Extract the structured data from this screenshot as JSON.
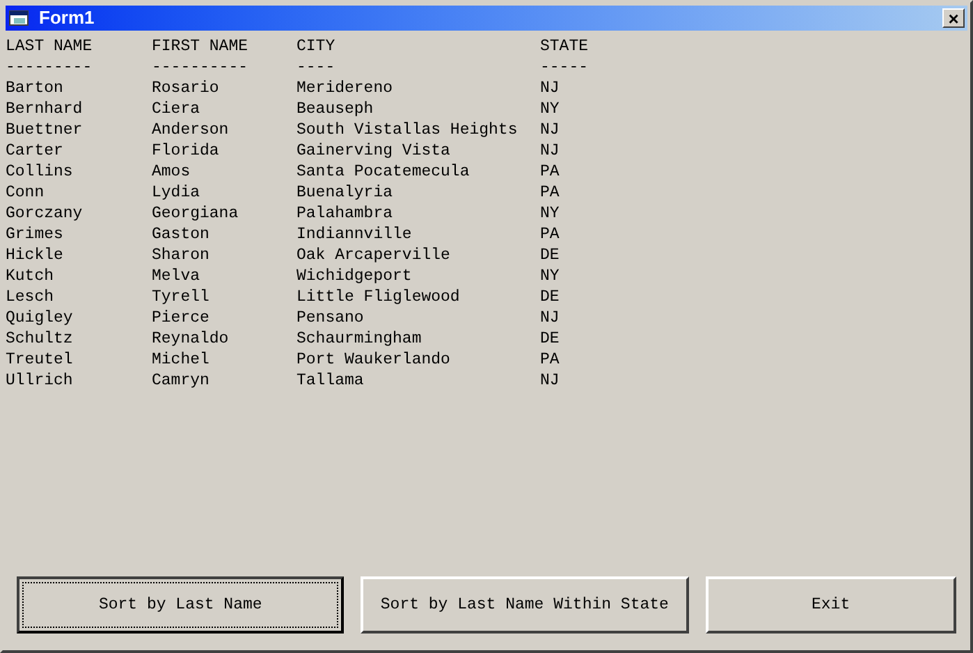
{
  "window": {
    "title": "Form1",
    "close": "×"
  },
  "table": {
    "columns": [
      "LAST NAME",
      "FIRST NAME",
      "CITY",
      "STATE"
    ],
    "separators": [
      "---------",
      "----------",
      "----",
      "-----"
    ],
    "rows": [
      [
        "Barton",
        "Rosario",
        "Meridereno",
        "NJ"
      ],
      [
        "Bernhard",
        "Ciera",
        "Beauseph",
        "NY"
      ],
      [
        "Buettner",
        "Anderson",
        "South Vistallas Heights",
        "NJ"
      ],
      [
        "Carter",
        "Florida",
        "Gainerving Vista",
        "NJ"
      ],
      [
        "Collins",
        "Amos",
        "Santa Pocatemecula",
        "PA"
      ],
      [
        "Conn",
        "Lydia",
        "Buenalyria",
        "PA"
      ],
      [
        "Gorczany",
        "Georgiana",
        "Palahambra",
        "NY"
      ],
      [
        "Grimes",
        "Gaston",
        "Indiannville",
        "PA"
      ],
      [
        "Hickle",
        "Sharon",
        "Oak Arcaperville",
        "DE"
      ],
      [
        "Kutch",
        "Melva",
        "Wichidgeport",
        "NY"
      ],
      [
        "Lesch",
        "Tyrell",
        "Little Fliglewood",
        "DE"
      ],
      [
        "Quigley",
        "Pierce",
        "Pensano",
        "NJ"
      ],
      [
        "Schultz",
        "Reynaldo",
        "Schaurmingham",
        "DE"
      ],
      [
        "Treutel",
        "Michel",
        "Port Waukerlando",
        "PA"
      ],
      [
        "Ullrich",
        "Camryn",
        "Tallama",
        "NJ"
      ]
    ]
  },
  "buttons": [
    {
      "label": "Sort by Last Name",
      "focused": true
    },
    {
      "label": "Sort by Last Name Within State",
      "focused": false
    },
    {
      "label": "Exit",
      "focused": false
    }
  ]
}
